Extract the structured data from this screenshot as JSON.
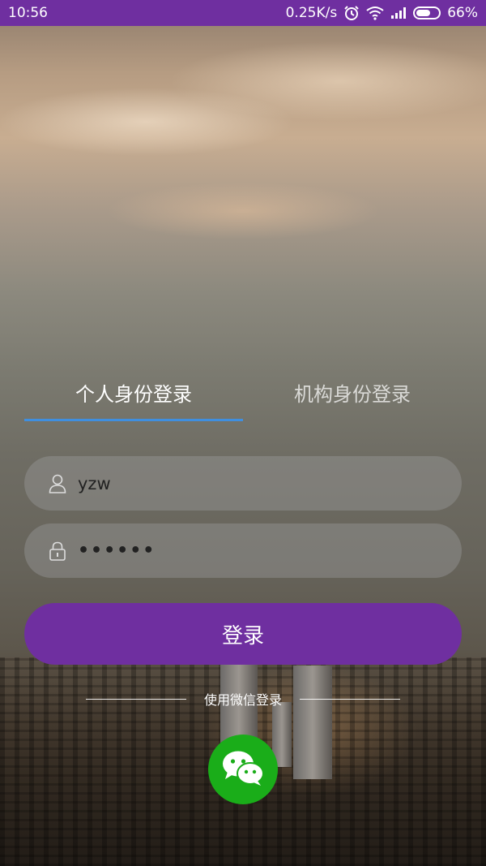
{
  "status_bar": {
    "time": "10:56",
    "net_speed": "0.25K/s",
    "battery": "66%",
    "battery_level": 0.66,
    "icons": [
      "alarm-icon",
      "wifi-icon",
      "signal-icon",
      "battery-icon"
    ]
  },
  "tabs": [
    {
      "label": "个人身份登录",
      "selected": true
    },
    {
      "label": "机构身份登录",
      "selected": false
    }
  ],
  "form": {
    "username": {
      "value": "yzw",
      "icon": "user-icon"
    },
    "password": {
      "masked_value": "••••••",
      "icon": "lock-icon"
    }
  },
  "login_button": {
    "label": "登录"
  },
  "alt_login": {
    "label": "使用微信登录",
    "icon": "wechat-icon"
  },
  "colors": {
    "accent": "#6f2fa0",
    "tab_indicator": "#3f8fe0",
    "wechat": "#1aad19"
  }
}
